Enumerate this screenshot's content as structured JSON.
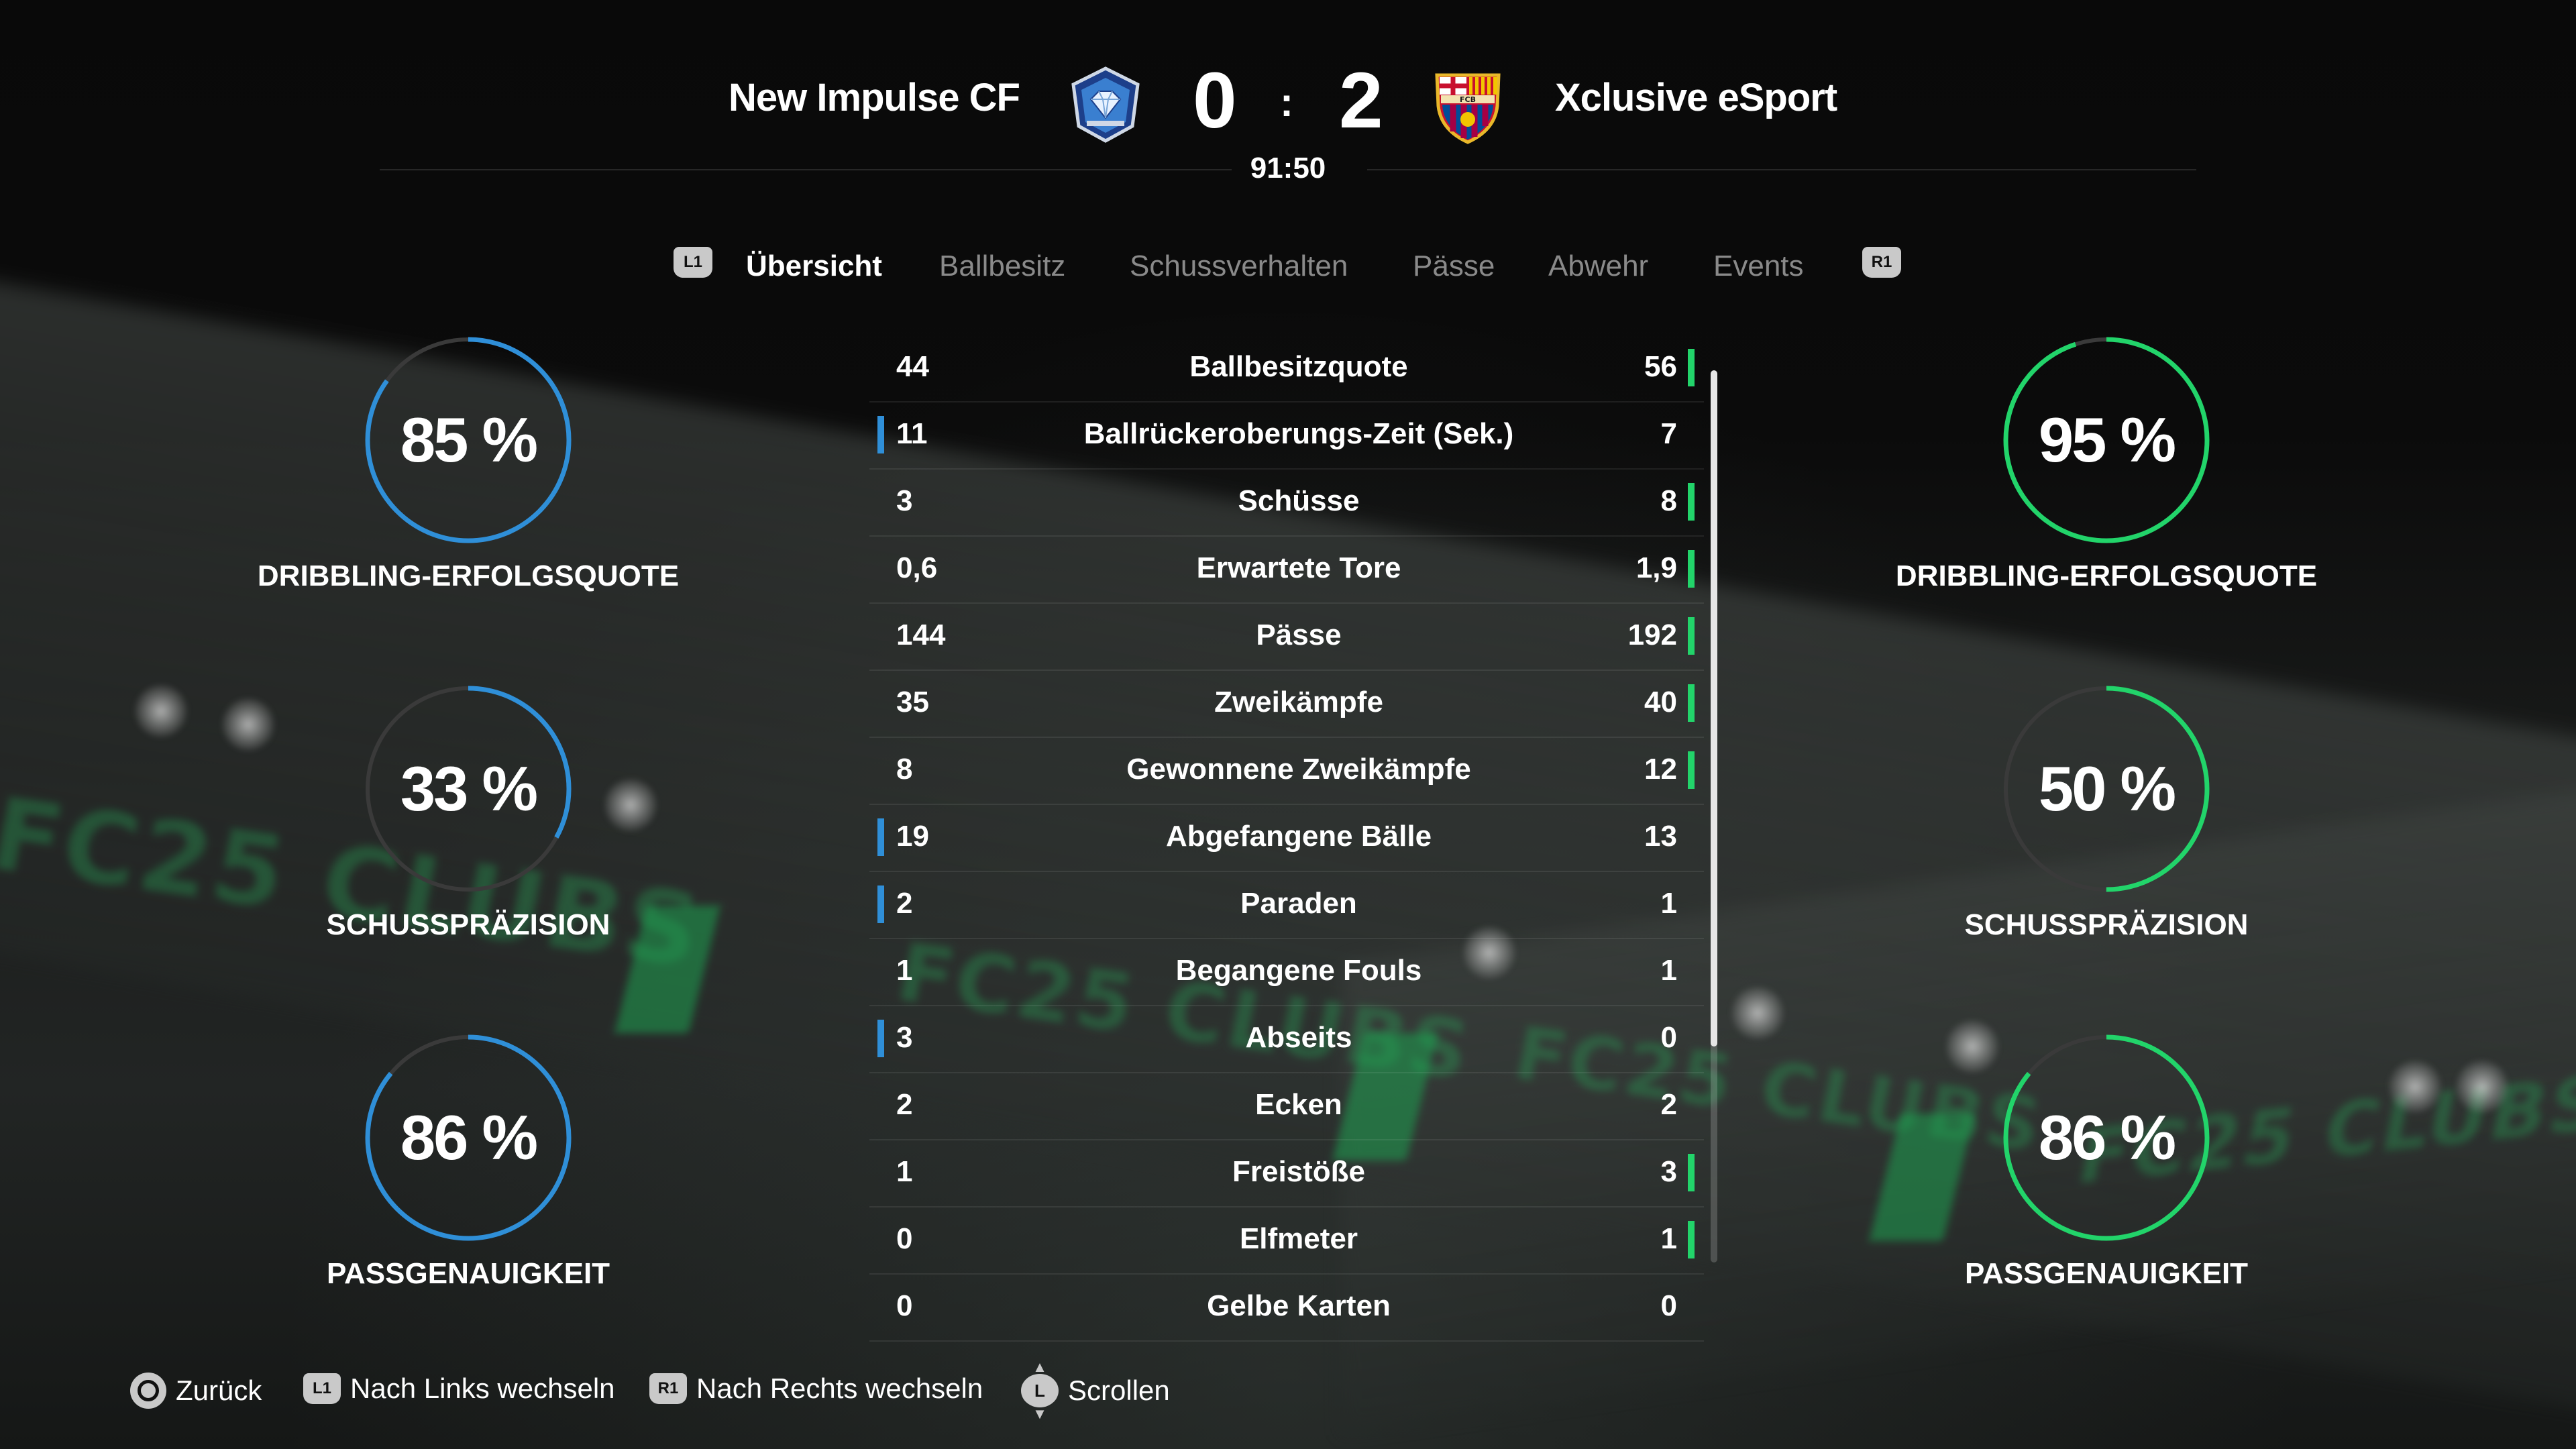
{
  "match": {
    "home_team": "New Impulse CF",
    "away_team": "Xclusive eSport",
    "home_score": "0",
    "away_score": "2",
    "separator": ":",
    "clock": "91:50"
  },
  "tabs": {
    "left_button": "L1",
    "right_button": "R1",
    "items": [
      "Übersicht",
      "Ballbesitz",
      "Schussverhalten",
      "Pässe",
      "Abwehr",
      "Events"
    ],
    "active": "Übersicht"
  },
  "stats": [
    {
      "label": "Ballbesitzquote",
      "home": "44",
      "away": "56",
      "highlight": "away"
    },
    {
      "label": "Ballrückeroberungs-Zeit (Sek.)",
      "home": "11",
      "away": "7",
      "highlight": "home"
    },
    {
      "label": "Schüsse",
      "home": "3",
      "away": "8",
      "highlight": "away"
    },
    {
      "label": "Erwartete Tore",
      "home": "0,6",
      "away": "1,9",
      "highlight": "away"
    },
    {
      "label": "Pässe",
      "home": "144",
      "away": "192",
      "highlight": "away"
    },
    {
      "label": "Zweikämpfe",
      "home": "35",
      "away": "40",
      "highlight": "away"
    },
    {
      "label": "Gewonnene Zweikämpfe",
      "home": "8",
      "away": "12",
      "highlight": "away"
    },
    {
      "label": "Abgefangene Bälle",
      "home": "19",
      "away": "13",
      "highlight": "home"
    },
    {
      "label": "Paraden",
      "home": "2",
      "away": "1",
      "highlight": "home"
    },
    {
      "label": "Begangene Fouls",
      "home": "1",
      "away": "1",
      "highlight": "none"
    },
    {
      "label": "Abseits",
      "home": "3",
      "away": "0",
      "highlight": "home"
    },
    {
      "label": "Ecken",
      "home": "2",
      "away": "2",
      "highlight": "none"
    },
    {
      "label": "Freistöße",
      "home": "1",
      "away": "3",
      "highlight": "away"
    },
    {
      "label": "Elfmeter",
      "home": "0",
      "away": "1",
      "highlight": "away"
    },
    {
      "label": "Gelbe Karten",
      "home": "0",
      "away": "0",
      "highlight": "none"
    }
  ],
  "gauges": {
    "home": [
      {
        "value": "85 %",
        "fraction": 0.85,
        "label": "DRIBBLING-ERFOLGSQUOTE"
      },
      {
        "value": "33 %",
        "fraction": 0.33,
        "label": "SCHUSSPRÄZISION"
      },
      {
        "value": "86 %",
        "fraction": 0.86,
        "label": "PASSGENAUIGKEIT"
      }
    ],
    "away": [
      {
        "value": "95 %",
        "fraction": 0.95,
        "label": "DRIBBLING-ERFOLGSQUOTE"
      },
      {
        "value": "50 %",
        "fraction": 0.5,
        "label": "SCHUSSPRÄZISION"
      },
      {
        "value": "86 %",
        "fraction": 0.86,
        "label": "PASSGENAUIGKEIT"
      }
    ]
  },
  "footer": {
    "back": "Zurück",
    "left_button": "L1",
    "left_label": "Nach Links wechseln",
    "right_button": "R1",
    "right_label": "Nach Rechts wechseln",
    "stick_button": "L",
    "scroll_label": "Scrollen"
  },
  "colors": {
    "home_accent": "#2f8fd8",
    "away_accent": "#22d46a",
    "track": "#3a3a3a"
  },
  "icons": {
    "home_crest": "diamond-shield-crest-icon",
    "away_crest": "fc-barcelona-crest-icon"
  }
}
